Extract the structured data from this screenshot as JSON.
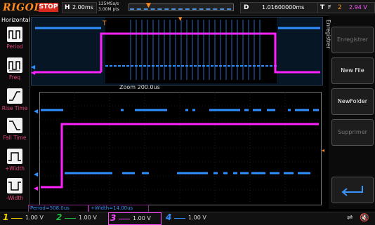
{
  "topbar": {
    "brand": "RIGOL",
    "run_state": "STOP",
    "horizontal_key": "H",
    "timebase": "2.00ms",
    "sample_rate": "125MSa/s",
    "mem_depth": "3.00M pts",
    "delay_key": "D",
    "delay": "1.01600000ms",
    "trigger_key": "T",
    "trigger_type": "F",
    "trigger_source": "2",
    "trigger_level": "2.94 V"
  },
  "left_menu": {
    "title": "Horizontal",
    "items": [
      {
        "label": "Period",
        "icon": "period-icon"
      },
      {
        "label": "Freq",
        "icon": "frequency-icon"
      },
      {
        "label": "Rise Time",
        "icon": "rise-time-icon"
      },
      {
        "label": "Fall Time",
        "icon": "fall-time-icon"
      },
      {
        "label": "+Width",
        "icon": "positive-width-icon"
      },
      {
        "label": "-Width",
        "icon": "negative-width-icon"
      }
    ]
  },
  "right_menu": {
    "title": "Enregistrer",
    "buttons": [
      {
        "label": "Enregistrer",
        "enabled": false
      },
      {
        "label": "New File",
        "enabled": true
      },
      {
        "label": "NewFolder",
        "enabled": true
      },
      {
        "label": "Supprimer",
        "enabled": false
      },
      {
        "label": "",
        "icon": "return-icon",
        "enabled": true
      }
    ]
  },
  "zoom": {
    "label": "Zoom 200.0us"
  },
  "measurements": [
    {
      "label": "Period=508.0us"
    },
    {
      "label": "+Width=14.00us"
    }
  ],
  "channels": [
    {
      "num": "1",
      "scale": "1.00 V",
      "color": "#f2d500"
    },
    {
      "num": "2",
      "scale": "1.00 V",
      "color": "#1fbf3f"
    },
    {
      "num": "3",
      "scale": "1.00 V",
      "color": "#ff44ff"
    },
    {
      "num": "4",
      "scale": "1.00 V",
      "color": "#2f8fff"
    }
  ],
  "colors": {
    "brand": "#ff8a1f",
    "ch3_trace": "#ff22ff",
    "ch4_trace": "#2f8fff",
    "stop": "#d9281e"
  }
}
